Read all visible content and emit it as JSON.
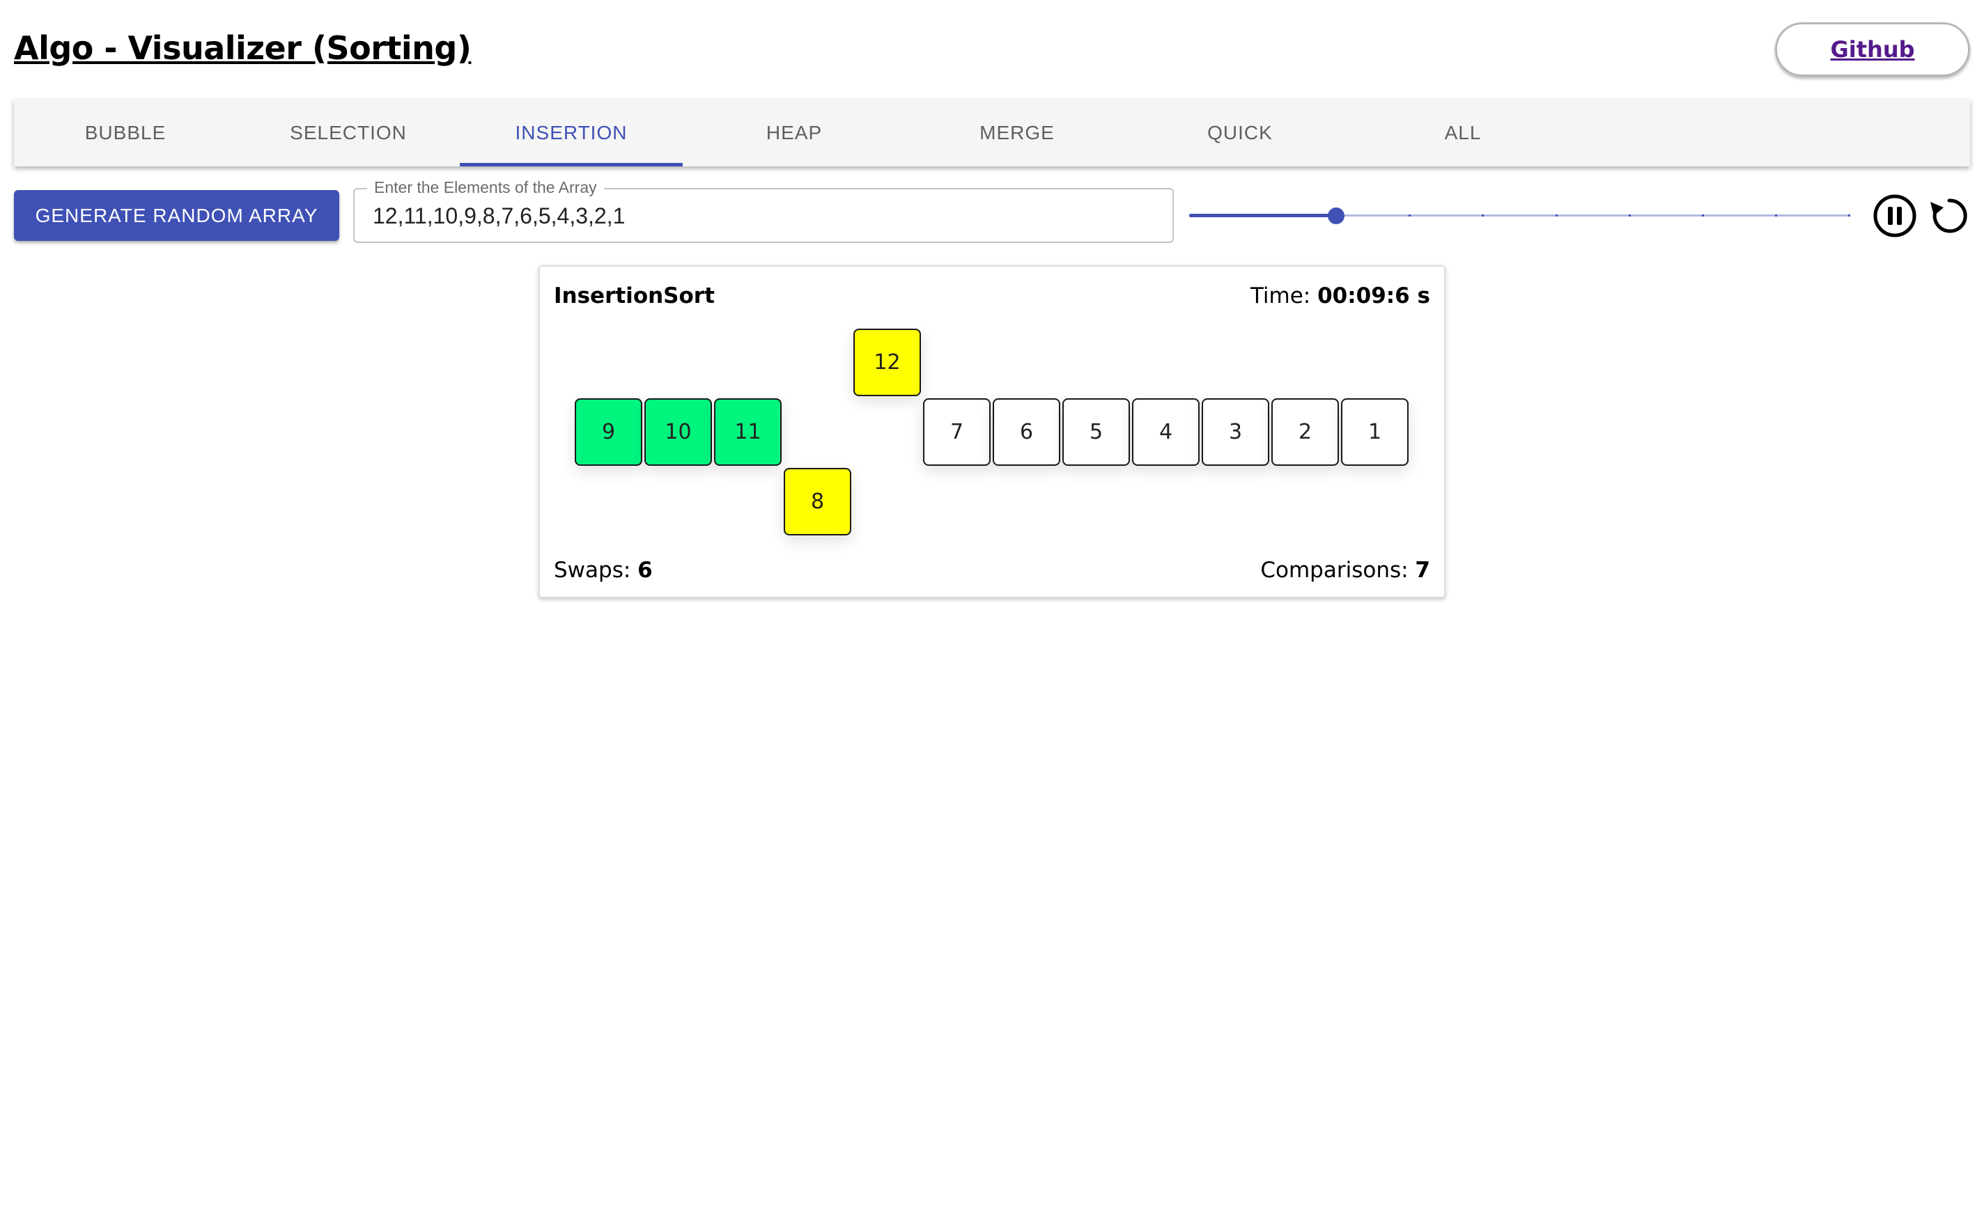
{
  "app": {
    "title": "Algo - Visualizer (Sorting)",
    "github_label": "Github"
  },
  "tabs": [
    {
      "label": "BUBBLE",
      "active": false
    },
    {
      "label": "SELECTION",
      "active": false
    },
    {
      "label": "INSERTION",
      "active": true
    },
    {
      "label": "HEAP",
      "active": false
    },
    {
      "label": "MERGE",
      "active": false
    },
    {
      "label": "QUICK",
      "active": false
    },
    {
      "label": "ALL",
      "active": false
    }
  ],
  "controls": {
    "generate_label": "GENERATE RANDOM ARRAY",
    "array_label": "Enter the Elements of the Array",
    "array_value": "12,11,10,9,8,7,6,5,4,3,2,1",
    "speed_slider": {
      "min": 0,
      "max": 9,
      "step": 1,
      "value": 2
    },
    "pause_icon": "pause-circle-icon",
    "reset_icon": "restart-icon"
  },
  "colors": {
    "accent": "#3f51b5",
    "sorted": "#00f57f",
    "active": "#ffff00",
    "idle": "#ffffff"
  },
  "visualizer": {
    "title": "InsertionSort",
    "time_label": "Time:",
    "time_value": "00:09:6 s",
    "swaps_label": "Swaps:",
    "swaps_value": "6",
    "comparisons_label": "Comparisons:",
    "comparisons_value": "7",
    "elements": [
      {
        "value": "9",
        "state": "sorted",
        "level": 0
      },
      {
        "value": "10",
        "state": "sorted",
        "level": 0
      },
      {
        "value": "11",
        "state": "sorted",
        "level": 0
      },
      {
        "value": "8",
        "state": "active",
        "level": -1
      },
      {
        "value": "12",
        "state": "active",
        "level": 1
      },
      {
        "value": "7",
        "state": "idle",
        "level": 0
      },
      {
        "value": "6",
        "state": "idle",
        "level": 0
      },
      {
        "value": "5",
        "state": "idle",
        "level": 0
      },
      {
        "value": "4",
        "state": "idle",
        "level": 0
      },
      {
        "value": "3",
        "state": "idle",
        "level": 0
      },
      {
        "value": "2",
        "state": "idle",
        "level": 0
      },
      {
        "value": "1",
        "state": "idle",
        "level": 0
      }
    ]
  }
}
